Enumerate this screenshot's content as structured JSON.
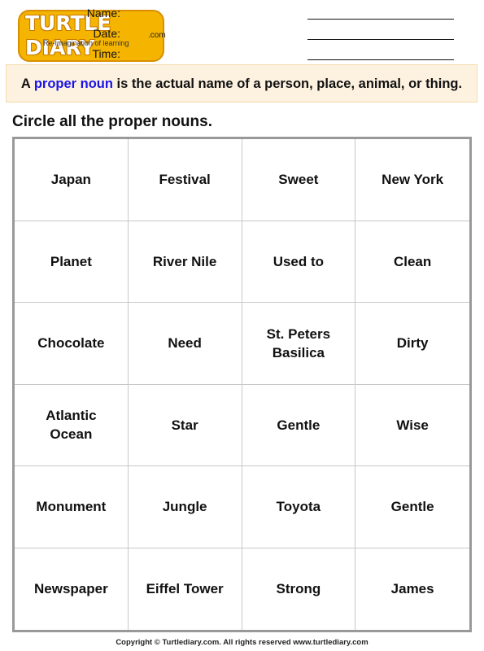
{
  "logo": {
    "name": "TURTLE DIARY",
    "domain_suffix": ".com",
    "tagline": "Re-Imagination of learning"
  },
  "fields": [
    {
      "label": "Name:"
    },
    {
      "label": "Date:"
    },
    {
      "label": "Time:"
    }
  ],
  "definition": {
    "prefix": "A ",
    "term": "proper noun",
    "suffix": " is the actual name of a person, place, animal, or thing.",
    "term_color": "#1a14e8",
    "background": "#fdf2e0"
  },
  "instruction": "Circle all the proper nouns.",
  "grid": {
    "rows": [
      [
        "Japan",
        "Festival",
        "Sweet",
        "New York"
      ],
      [
        "Planet",
        "River Nile",
        "Used to",
        "Clean"
      ],
      [
        "Chocolate",
        "Need",
        "St. Peters Basilica",
        "Dirty"
      ],
      [
        "Atlantic Ocean",
        "Star",
        "Gentle",
        "Wise"
      ],
      [
        "Monument",
        "Jungle",
        "Toyota",
        "Gentle"
      ],
      [
        "Newspaper",
        "Eiffel Tower",
        "Strong",
        "James"
      ]
    ]
  },
  "footer": "Copyright © Turtlediary.com. All rights reserved  www.turtlediary.com"
}
